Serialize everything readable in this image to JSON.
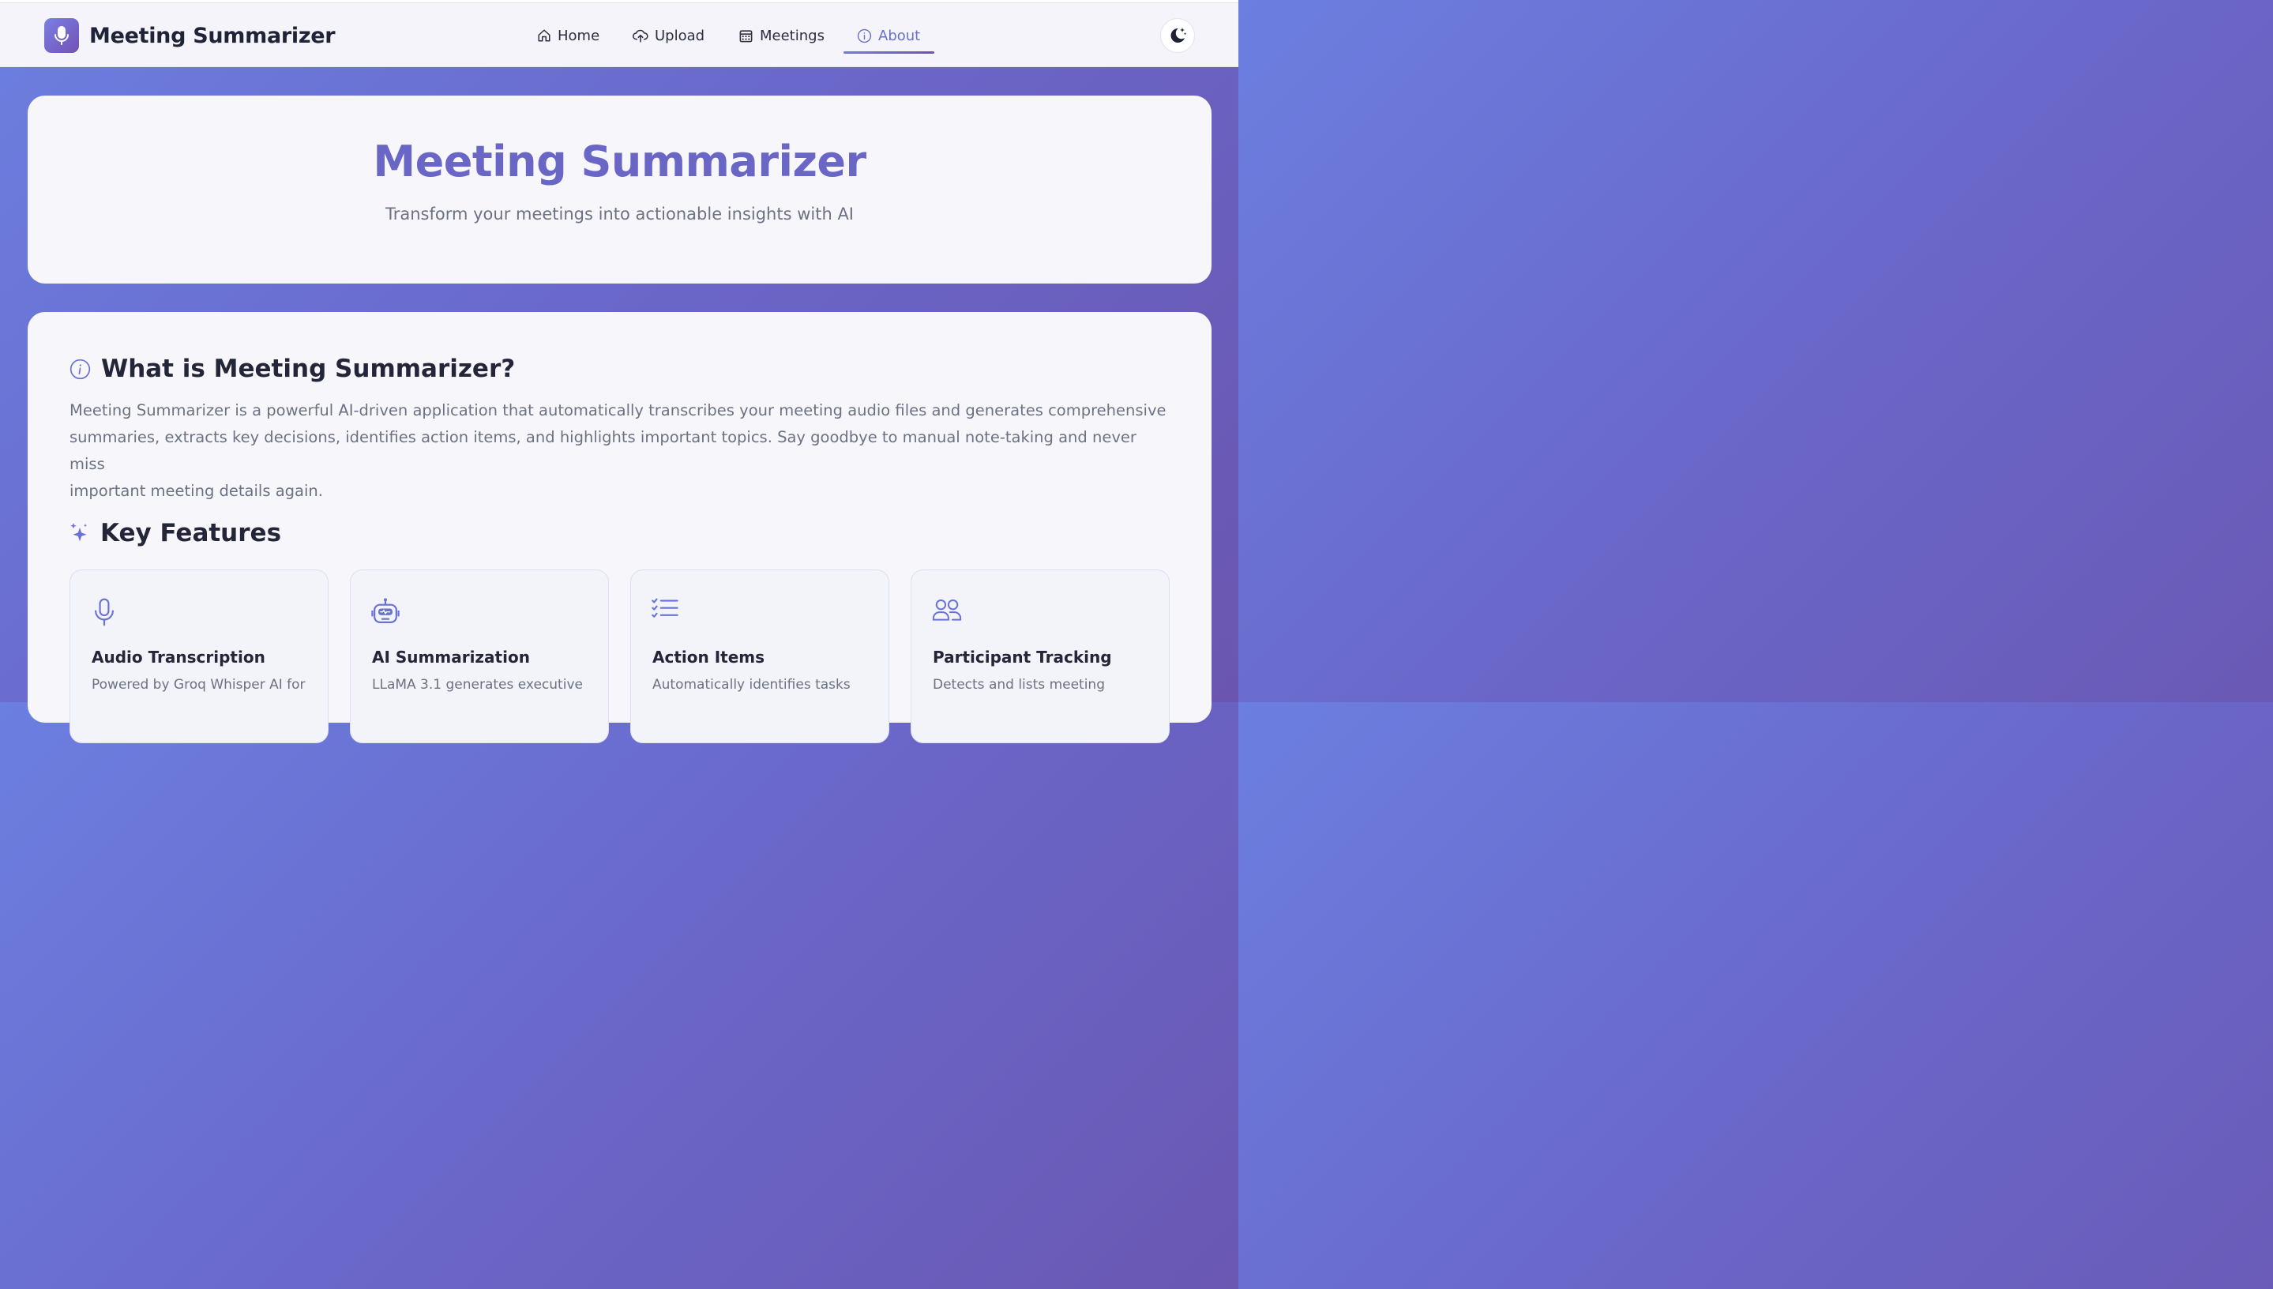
{
  "app": {
    "title": "Meeting Summarizer"
  },
  "nav": {
    "items": [
      {
        "label": "Home",
        "icon": "home-icon"
      },
      {
        "label": "Upload",
        "icon": "cloud-upload-icon"
      },
      {
        "label": "Meetings",
        "icon": "calendar-icon"
      },
      {
        "label": "About",
        "icon": "info-icon",
        "active": true
      }
    ],
    "theme_toggle_icon": "moon-stars-icon"
  },
  "hero": {
    "title": "Meeting Summarizer",
    "subtitle": "Transform your meetings into actionable insights with AI"
  },
  "about": {
    "heading": "What is Meeting Summarizer?",
    "line1": "Meeting Summarizer is a powerful AI-driven application that automatically transcribes your meeting audio files and generates comprehensive",
    "line2": "summaries, extracts key decisions, identifies action items, and highlights important topics. Say goodbye to manual note-taking and never miss",
    "line3": "important meeting details again."
  },
  "features": {
    "heading": "Key Features",
    "cards": [
      {
        "title": "Audio Transcription",
        "desc": "Powered by Groq Whisper AI for",
        "icon": "microphone-icon"
      },
      {
        "title": "AI Summarization",
        "desc": "LLaMA 3.1 generates executive",
        "icon": "robot-icon"
      },
      {
        "title": "Action Items",
        "desc": "Automatically identifies tasks",
        "icon": "checklist-icon"
      },
      {
        "title": "Participant Tracking",
        "desc": "Detects and lists meeting",
        "icon": "users-icon"
      }
    ]
  },
  "colors": {
    "accent": "#6a66c6",
    "accent_light": "#6f79df",
    "accent_dark": "#7250b4",
    "text_dark": "#222638",
    "text_muted": "#6b7283"
  }
}
